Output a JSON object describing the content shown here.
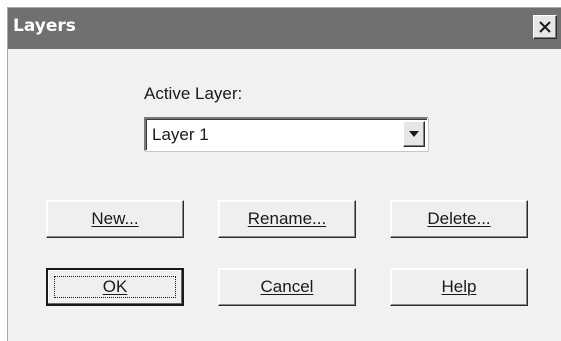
{
  "dialog": {
    "title": "Layers",
    "close_icon": "close-icon"
  },
  "active_layer": {
    "label": "Active Layer:",
    "selected": "Layer 1",
    "arrow_icon": "dropdown-arrow-icon"
  },
  "buttons": {
    "new": "New...",
    "rename": "Rename...",
    "delete": "Delete...",
    "ok": "OK",
    "cancel": "Cancel",
    "help": "Help"
  }
}
